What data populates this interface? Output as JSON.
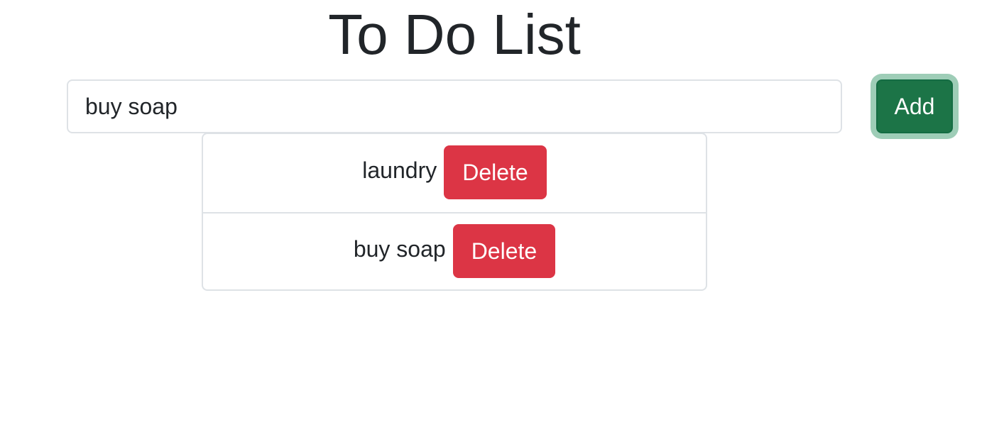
{
  "header": {
    "title": "To Do List"
  },
  "form": {
    "input_value": "buy soap",
    "add_label": "Add"
  },
  "tasks": [
    {
      "text": "laundry",
      "delete_label": "Delete"
    },
    {
      "text": "buy soap",
      "delete_label": "Delete"
    }
  ],
  "colors": {
    "add_button": "#1c7447",
    "delete_button": "#dc3545",
    "text": "#212529",
    "border": "#dee2e6"
  }
}
